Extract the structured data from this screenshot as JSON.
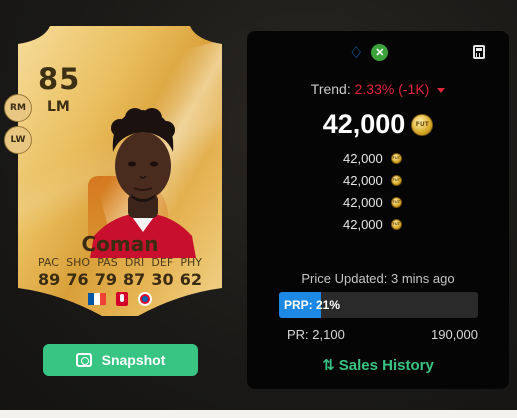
{
  "card": {
    "rating": "85",
    "position": "LM",
    "alt_positions": [
      "RM",
      "LW"
    ],
    "name": "Coman",
    "stat_labels": [
      "PAC",
      "SHO",
      "PAS",
      "DRI",
      "DEF",
      "PHY"
    ],
    "stat_values": [
      "89",
      "76",
      "79",
      "87",
      "30",
      "62"
    ],
    "nation": "France",
    "league": "Bundesliga",
    "club": "FC Bayern"
  },
  "snapshot": {
    "label": "Snapshot",
    "icon": "camera-scan-icon"
  },
  "panel": {
    "platform_icons": [
      "playstation-icon",
      "xbox-icon"
    ],
    "calculator_icon": "calculator-icon",
    "trend": {
      "label": "Trend:",
      "value": "2.33% (-1K)",
      "direction": "down",
      "color": "#e0263a"
    },
    "price": "42,000",
    "coin_label": "FUT",
    "recent_prices": [
      "42,000",
      "42,000",
      "42,000",
      "42,000"
    ],
    "updated": "Price Updated: 3 mins ago",
    "prp": {
      "label": "PRP: 21%",
      "percent": 21
    },
    "price_range": {
      "min": "PR: 2,100",
      "max": "190,000"
    },
    "sales_history": "Sales History"
  },
  "colors": {
    "accent_green": "#38c483",
    "prp_blue": "#1d89e4",
    "panel_bg": "#050505",
    "card_gold": "#e9bd5c"
  }
}
